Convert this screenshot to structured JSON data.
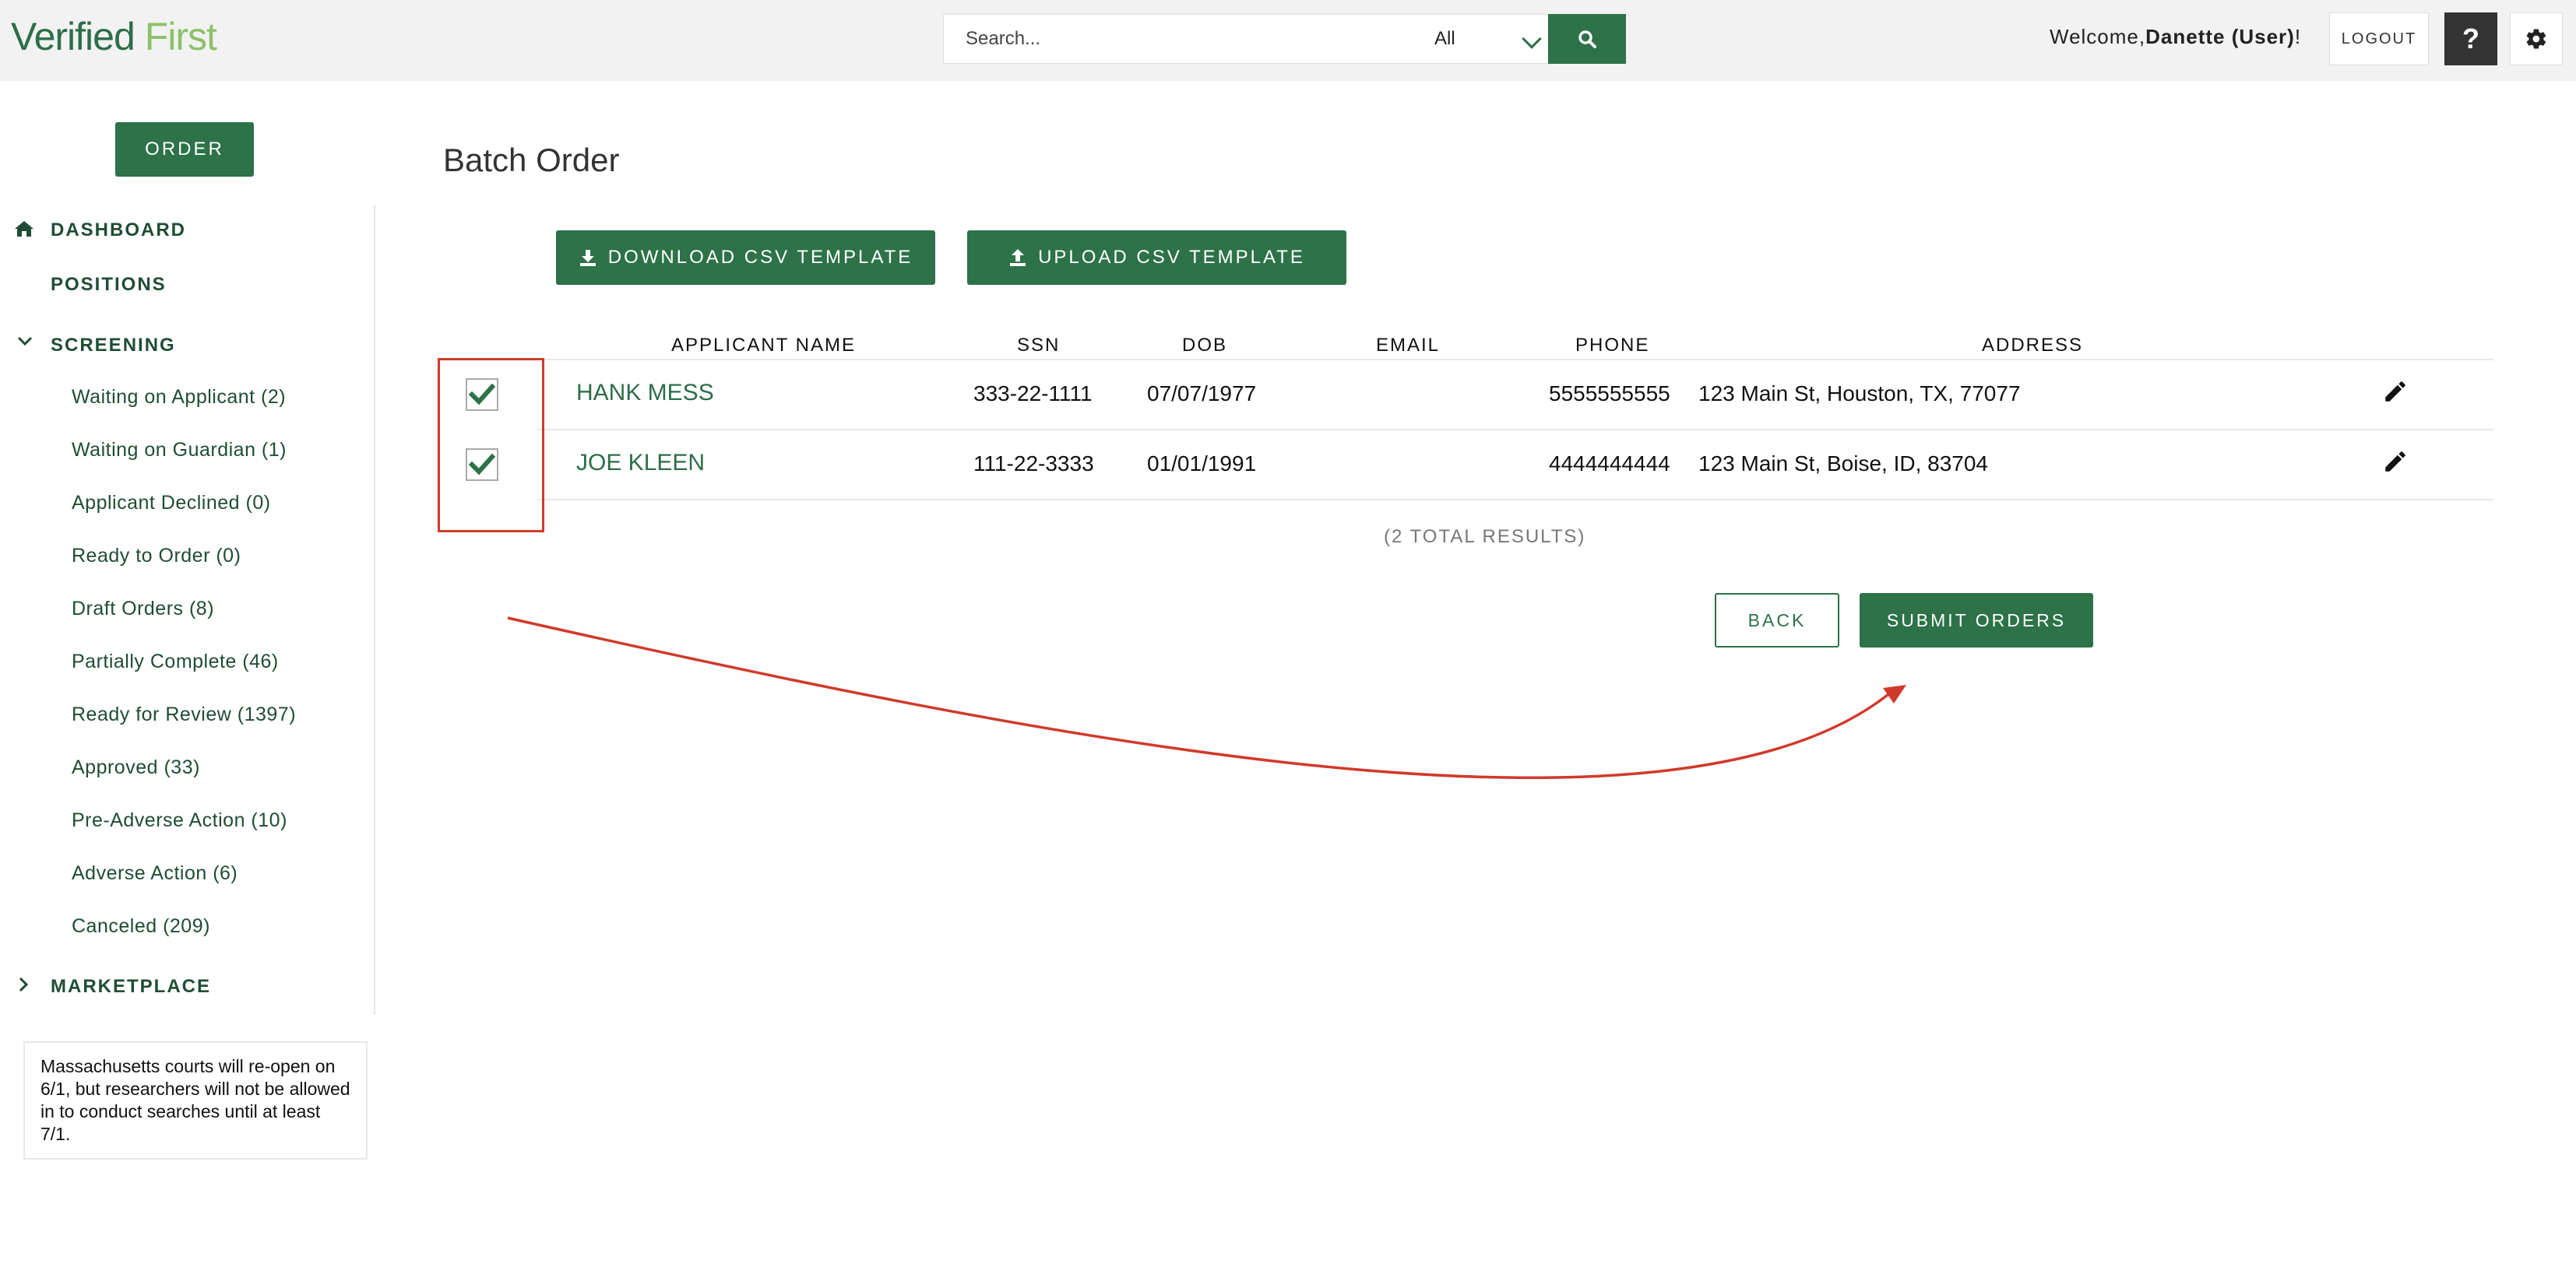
{
  "header": {
    "logo_part1": "Verified",
    "logo_part2": "First",
    "search_placeholder": "Search...",
    "search_scope": "All",
    "welcome_prefix": "Welcome,",
    "welcome_user": "Danette (User)",
    "welcome_suffix": "!",
    "logout_label": "LOGOUT",
    "help_label": "?"
  },
  "sidebar": {
    "order_label": "ORDER",
    "dashboard_label": "DASHBOARD",
    "positions_label": "POSITIONS",
    "screening_label": "SCREENING",
    "screening_items": [
      "Waiting on Applicant (2)",
      "Waiting on Guardian (1)",
      "Applicant Declined (0)",
      "Ready to Order (0)",
      "Draft Orders (8)",
      "Partially Complete (46)",
      "Ready for Review (1397)",
      "Approved (33)",
      "Pre-Adverse Action (10)",
      "Adverse Action (6)",
      "Canceled (209)"
    ],
    "marketplace_label": "MARKETPLACE",
    "notice": "Massachusetts courts will re-open on 6/1, but researchers will not be allowed in to conduct searches until at least 7/1."
  },
  "main": {
    "title": "Batch Order",
    "download_label": "DOWNLOAD CSV TEMPLATE",
    "upload_label": "UPLOAD CSV TEMPLATE",
    "columns": [
      "APPLICANT NAME",
      "SSN",
      "DOB",
      "EMAIL",
      "PHONE",
      "ADDRESS"
    ],
    "rows": [
      {
        "name": "HANK MESS",
        "ssn": "333-22-1111",
        "dob": "07/07/1977",
        "email": "",
        "phone": "5555555555",
        "address": "123 Main St, Houston, TX, 77077",
        "checked": true
      },
      {
        "name": "JOE KLEEN",
        "ssn": "111-22-3333",
        "dob": "01/01/1991",
        "email": "",
        "phone": "4444444444",
        "address": "123 Main St, Boise, ID, 83704",
        "checked": true
      }
    ],
    "total_results": "(2 TOTAL RESULTS)",
    "back_label": "BACK",
    "submit_label": "SUBMIT ORDERS"
  },
  "colors": {
    "brand_green": "#2d7248",
    "logo_light_green": "#8cc16a",
    "annotation_red": "#d03a2b"
  }
}
